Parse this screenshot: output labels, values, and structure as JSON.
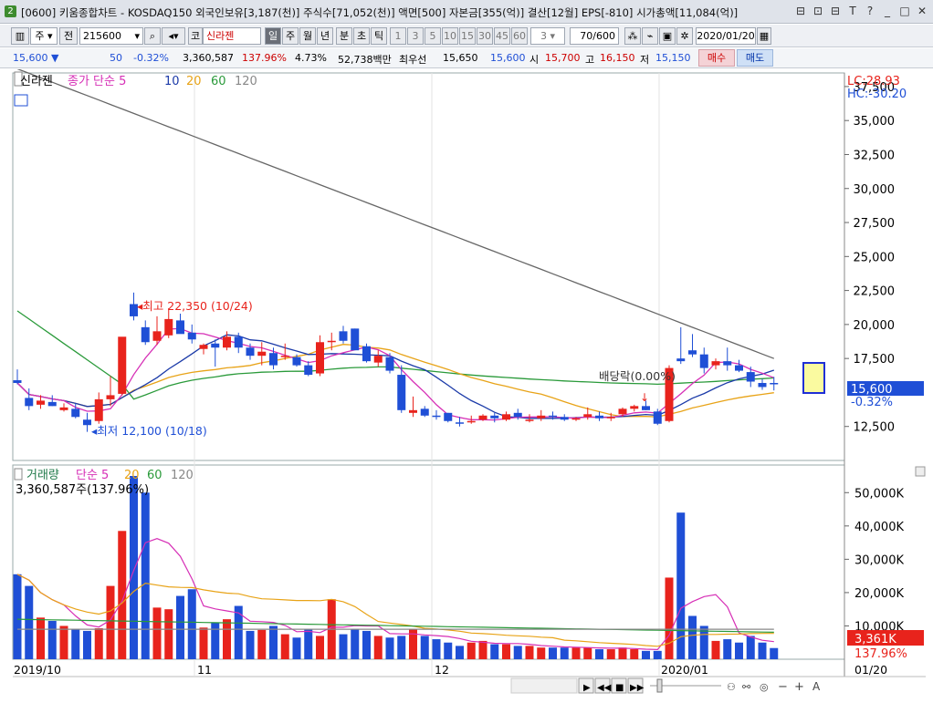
{
  "window": {
    "num": "2",
    "title": "[0600] 키움종합차트 - KOSDAQ150 외국인보유[3,187(천)] 주식수[71,052(천)] 액면[500] 자본금[355(억)] 결산[12월] EPS[-810] 시가총액[11,084(억)]",
    "buttons": [
      "⊟",
      "⊡",
      "⊟",
      "T",
      "?",
      "_",
      "□",
      "✕"
    ]
  },
  "toolbar": {
    "period_unit": "주",
    "prev_label": "전",
    "code": "215600",
    "market_label": "코",
    "name": "신라젠",
    "periods": [
      "일",
      "주",
      "월",
      "년",
      "분",
      "초",
      "틱"
    ],
    "active_period": "일",
    "intervals": [
      "1",
      "3",
      "5",
      "10",
      "15",
      "30",
      "45",
      "60"
    ],
    "interval_value": "3",
    "count": "70/600",
    "date": "2020/01/20"
  },
  "quote": {
    "price": "15,600",
    "arrow": "▼",
    "change": "50",
    "change_pct": "-0.32%",
    "volume": "3,360,587",
    "vol_ratio": "137.96%",
    "turnover": "4.73%",
    "amount": "52,738백만",
    "pref_label": "최우선",
    "pref_ask": "15,650",
    "pref_bid": "15,600",
    "open_label": "시",
    "open": "15,700",
    "high_label": "고",
    "high": "16,150",
    "low_label": "저",
    "low": "15,150",
    "buy": "매수",
    "sell": "매도"
  },
  "price_panel": {
    "legend_name": "신라젠",
    "legend_ma": "종가 단순 5",
    "legend_periods": [
      "10",
      "20",
      "60",
      "120"
    ],
    "lc": "LC:28.93",
    "hc": "HC:-30.20",
    "price_tag": "15,600",
    "pct_tag": "-0.32%",
    "high_note": "최고 22,350 (10/24)",
    "low_note": "최저 12,100 (10/18)",
    "dividend_note": "배당락(0.00%)",
    "y_ticks": [
      "37,500",
      "35,000",
      "32,500",
      "30,000",
      "27,500",
      "25,000",
      "22,500",
      "20,000",
      "17,500",
      "12,500"
    ]
  },
  "volume_panel": {
    "legend_name": "거래량",
    "legend_ma": "단순 5",
    "legend_periods": [
      "20",
      "60",
      "120"
    ],
    "current": "3,360,587주(137.96%)",
    "y_ticks": [
      "50,000K",
      "40,000K",
      "30,000K",
      "20,000K",
      "10,000K"
    ],
    "vol_tag": "3,361K",
    "vol_pct_tag": "137.96%"
  },
  "x_axis": {
    "labels": [
      "2019/10",
      "11",
      "12",
      "2020/01"
    ],
    "right_label": "01/20"
  },
  "colors": {
    "up": "#e8231c",
    "down": "#1f4fd6",
    "ma5": "#d62fb6",
    "ma10": "#1b3aa8",
    "ma20": "#e8a317",
    "ma60": "#2a9a3a",
    "ma120": "#666666"
  },
  "chart_data": {
    "type": "candlestick",
    "title": "신라젠",
    "candles": [
      [
        15900,
        16700,
        15600,
        15700
      ],
      [
        14600,
        15300,
        13700,
        14000
      ],
      [
        14100,
        14800,
        13800,
        14400
      ],
      [
        14300,
        14800,
        14000,
        14000
      ],
      [
        13700,
        14200,
        13600,
        13900
      ],
      [
        13800,
        14200,
        13100,
        13200
      ],
      [
        13000,
        13500,
        12100,
        12600
      ],
      [
        12900,
        15000,
        12700,
        14500
      ],
      [
        14500,
        16200,
        14000,
        14800
      ],
      [
        14900,
        18500,
        14800,
        19100
      ],
      [
        21500,
        22350,
        20300,
        20600
      ],
      [
        19800,
        20300,
        18500,
        18700
      ],
      [
        18800,
        20600,
        18500,
        19500
      ],
      [
        19200,
        21200,
        19000,
        20400
      ],
      [
        20300,
        20800,
        19400,
        19300
      ],
      [
        19400,
        20000,
        18600,
        18900
      ],
      [
        18200,
        18600,
        17800,
        18500
      ],
      [
        18600,
        18900,
        16900,
        18300
      ],
      [
        18300,
        19500,
        18100,
        19100
      ],
      [
        19100,
        19400,
        17900,
        18300
      ],
      [
        18300,
        18600,
        17400,
        17700
      ],
      [
        17700,
        18700,
        17000,
        18000
      ],
      [
        17900,
        18300,
        16700,
        17000
      ],
      [
        17700,
        18600,
        17400,
        17700
      ],
      [
        17600,
        17800,
        16900,
        17000
      ],
      [
        17000,
        17300,
        16200,
        16300
      ],
      [
        16400,
        19200,
        16200,
        18700
      ],
      [
        18700,
        19400,
        18100,
        18800
      ],
      [
        19500,
        19900,
        18600,
        18800
      ],
      [
        19700,
        19700,
        18400,
        18100
      ],
      [
        18400,
        18600,
        17200,
        17300
      ],
      [
        17200,
        18100,
        16900,
        17700
      ],
      [
        17600,
        17900,
        16400,
        16600
      ],
      [
        16300,
        17000,
        13500,
        13700
      ],
      [
        13500,
        14700,
        13200,
        13700
      ],
      [
        13800,
        14000,
        13200,
        13300
      ],
      [
        13300,
        13700,
        13000,
        13200
      ],
      [
        13500,
        13500,
        12800,
        12900
      ],
      [
        12800,
        13200,
        12500,
        12700
      ],
      [
        12800,
        13300,
        12700,
        12900
      ],
      [
        13000,
        13400,
        12900,
        13300
      ],
      [
        13300,
        13500,
        12800,
        13100
      ],
      [
        13000,
        13600,
        12900,
        13400
      ],
      [
        13500,
        13800,
        13000,
        13200
      ],
      [
        13000,
        13400,
        12800,
        13000
      ],
      [
        13100,
        13700,
        12900,
        13300
      ],
      [
        13300,
        13600,
        13000,
        13200
      ],
      [
        13200,
        13400,
        12900,
        13000
      ],
      [
        13000,
        13200,
        12900,
        13100
      ],
      [
        13200,
        13900,
        13000,
        13400
      ],
      [
        13300,
        13600,
        12900,
        13100
      ],
      [
        13100,
        13500,
        12900,
        13200
      ],
      [
        13400,
        13900,
        13200,
        13800
      ],
      [
        13800,
        14100,
        13600,
        14000
      ],
      [
        14000,
        14400,
        13700,
        13700
      ],
      [
        13600,
        13800,
        12600,
        12700
      ],
      [
        12900,
        17000,
        12800,
        16800
      ],
      [
        17500,
        19800,
        17100,
        17300
      ],
      [
        18100,
        19300,
        17600,
        17800
      ],
      [
        17800,
        18300,
        16400,
        16800
      ],
      [
        17000,
        17500,
        16700,
        17300
      ],
      [
        17300,
        18300,
        16600,
        17000
      ],
      [
        17000,
        17400,
        16500,
        16600
      ],
      [
        16500,
        16900,
        15400,
        15800
      ],
      [
        15700,
        16000,
        15200,
        15400
      ],
      [
        15700,
        16150,
        15150,
        15600
      ]
    ],
    "volume_k": [
      25500,
      22000,
      12500,
      11500,
      10000,
      9000,
      8500,
      9300,
      22000,
      38500,
      55000,
      50000,
      15500,
      15000,
      19000,
      21000,
      9500,
      11000,
      12000,
      16000,
      8500,
      8800,
      10000,
      7500,
      6500,
      9000,
      7000,
      18000,
      7500,
      9000,
      8500,
      7000,
      6500,
      7000,
      9000,
      7000,
      6000,
      5000,
      4000,
      5000,
      5500,
      4500,
      4500,
      4000,
      4000,
      3500,
      3500,
      3500,
      3500,
      3500,
      3000,
      3000,
      3500,
      3000,
      2500,
      2500,
      24500,
      44000,
      13000,
      10000,
      5500,
      6000,
      5000,
      7000,
      5000,
      3361
    ],
    "ylim_price": [
      10000,
      38500
    ],
    "ylim_volume": [
      0,
      55000
    ],
    "highest": {
      "value": 22350,
      "date": "10/24"
    },
    "lowest": {
      "value": 12100,
      "date": "10/18"
    }
  }
}
